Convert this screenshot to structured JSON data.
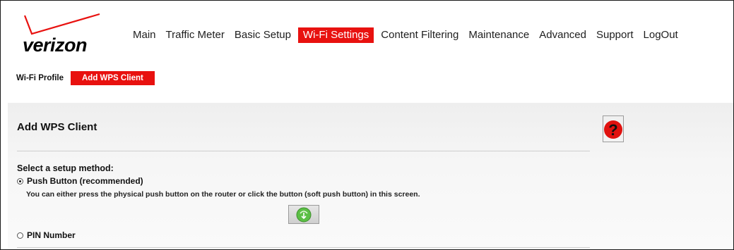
{
  "header": {
    "brand": "verizon",
    "nav": [
      {
        "label": "Main",
        "active": false
      },
      {
        "label": "Traffic Meter",
        "active": false
      },
      {
        "label": "Basic Setup",
        "active": false
      },
      {
        "label": "Wi-Fi Settings",
        "active": true
      },
      {
        "label": "Content Filtering",
        "active": false
      },
      {
        "label": "Maintenance",
        "active": false
      },
      {
        "label": "Advanced",
        "active": false
      },
      {
        "label": "Support",
        "active": false
      },
      {
        "label": "LogOut",
        "active": false
      }
    ]
  },
  "subtabs": [
    {
      "label": "Wi-Fi Profile",
      "active": false
    },
    {
      "label": "Add WPS Client",
      "active": true
    }
  ],
  "content": {
    "title": "Add WPS Client",
    "help_icon": "question-mark-icon",
    "section_label": "Select a setup method:",
    "push_button": {
      "label": "Push Button (recommended)",
      "selected": true,
      "description": "You can either press the physical push button on the router or click the button (soft push button) in this screen.",
      "button_icon": "wps-push-icon"
    },
    "pin": {
      "label": "PIN Number",
      "selected": false
    }
  },
  "colors": {
    "accent_red": "#e8110f",
    "check_red": "#e8110f",
    "wps_green": "#5bbf45"
  }
}
